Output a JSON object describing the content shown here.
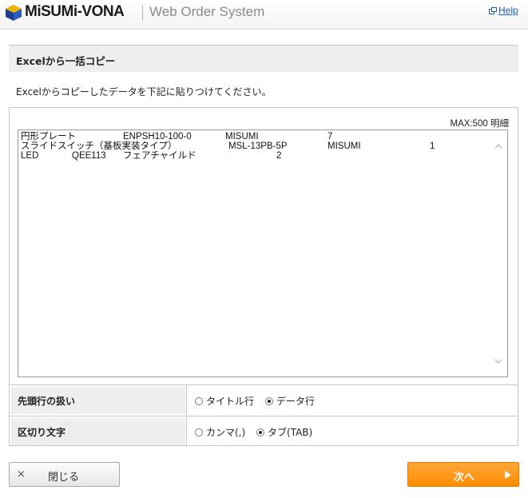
{
  "header": {
    "brand": "MiSUMi-VONA",
    "system_name": "Web Order System",
    "help_label": "Help"
  },
  "section": {
    "title": "Excelから一括コピー",
    "instruction": "Excelからコピーしたデータを下記に貼りつけてください。"
  },
  "panel": {
    "max_label": "MAX:500 明細",
    "rows": [
      [
        "円形プレート",
        "ENPSH10-100-0",
        "MISUMI",
        "7"
      ],
      [
        "スライドスイッチ（基板実装タイプ）",
        "MSL-13PB-5P",
        "MISUMI",
        "1"
      ],
      [
        "LED",
        "QEE113",
        "フェアチャイルド",
        "2"
      ]
    ]
  },
  "options": {
    "first_row": {
      "label": "先頭行の扱い",
      "choices": [
        "タイトル行",
        "データ行"
      ],
      "selected": "データ行"
    },
    "delimiter": {
      "label": "区切り文字",
      "choices": [
        "カンマ(,)",
        "タブ(TAB)"
      ],
      "selected": "タブ(TAB)"
    }
  },
  "buttons": {
    "close_symbol": "×",
    "close_label": "閉じる",
    "next_label": "次へ"
  },
  "colors": {
    "accent": "#ff8c00",
    "link": "#1a5fb4"
  }
}
